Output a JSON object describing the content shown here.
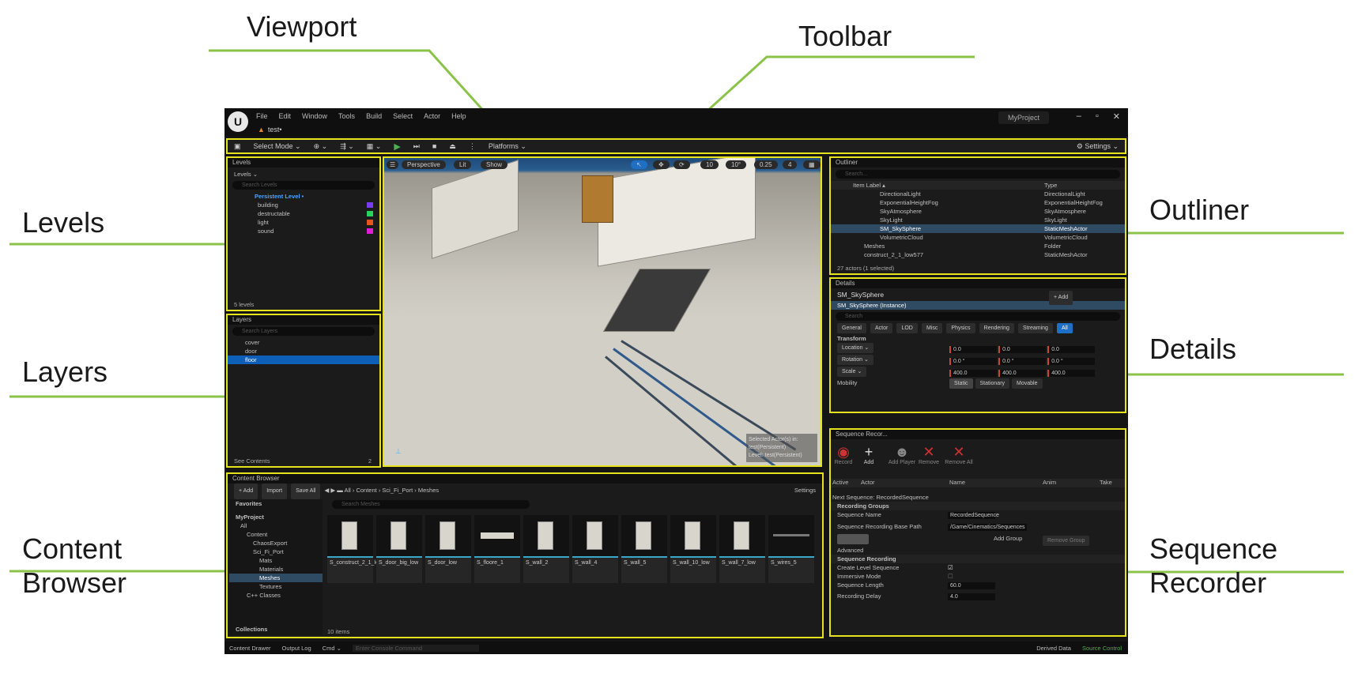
{
  "callouts": {
    "viewport": "Viewport",
    "toolbar": "Toolbar",
    "levels": "Levels",
    "layers": "Layers",
    "outliner": "Outliner",
    "details": "Details",
    "content_browser_1": "Content",
    "content_browser_2": "Browser",
    "sequence_recorder_1": "Sequence",
    "sequence_recorder_2": "Recorder"
  },
  "menubar": {
    "logo": "U",
    "items": [
      "File",
      "Edit",
      "Window",
      "Tools",
      "Build",
      "Select",
      "Actor",
      "Help"
    ],
    "tab": "test•",
    "project": "MyProject"
  },
  "toolbar": {
    "save": "💾",
    "select_mode": "Select Mode ⌄",
    "platforms": "Platforms ⌄",
    "settings": "⚙ Settings ⌄"
  },
  "levels": {
    "tab": "Levels",
    "dropdown": "Levels ⌄",
    "search": "Search Levels",
    "rows": [
      "Persistent Level •",
      "building",
      "destructable",
      "light",
      "sound"
    ],
    "colors": [
      "#b0b0b0",
      "#7a3cf0",
      "#29d35f",
      "#e6551e",
      "#e01ed8"
    ],
    "footer": "5 levels"
  },
  "layers": {
    "tab": "Layers",
    "search": "Search Layers",
    "rows": [
      "cover",
      "door",
      "floor"
    ],
    "footer": "See Contents",
    "count": "2"
  },
  "viewport": {
    "perspective": "Perspective",
    "lit": "Lit",
    "show": "Show",
    "grid": "10",
    "angle": "10°",
    "scale": "0.25",
    "cams": "4",
    "info_1": "Selected Actor(s) in:",
    "info_2": "test(Persistent)",
    "info_3": "Level: test(Persistent)"
  },
  "outliner": {
    "tab": "Outliner",
    "search": "Search...",
    "col_label": "Item Label ▴",
    "col_type": "Type",
    "rows": [
      [
        "DirectionalLight",
        "DirectionalLight"
      ],
      [
        "ExponentialHeightFog",
        "ExponentialHeightFog"
      ],
      [
        "SkyAtmosphere",
        "SkyAtmosphere"
      ],
      [
        "SkyLight",
        "SkyLight"
      ],
      [
        "SM_SkySphere",
        "StaticMeshActor"
      ],
      [
        "VolumetricCloud",
        "VolumetricCloud"
      ],
      [
        "Meshes",
        "Folder"
      ],
      [
        "construct_2_1_low577",
        "StaticMeshActor"
      ]
    ],
    "footer": "27 actors (1 selected)"
  },
  "details": {
    "tab": "Details",
    "name": "SM_SkySphere",
    "add": "+ Add",
    "instance": "SM_SkySphere (Instance)",
    "search": "Search",
    "filters": [
      "General",
      "Actor",
      "LOD",
      "Misc",
      "Physics",
      "Rendering",
      "Streaming",
      "All"
    ],
    "section": "Transform",
    "location": "Location ⌄",
    "rotation": "Rotation ⌄",
    "scale": "Scale ⌄",
    "loc": [
      "0.0",
      "0.0",
      "0.0"
    ],
    "rot": [
      "0.0 °",
      "0.0 °",
      "0.0 °"
    ],
    "scl": [
      "400.0",
      "400.0",
      "400.0"
    ],
    "mobility": "Mobility",
    "mob_opts": [
      "Static",
      "Stationary",
      "Movable"
    ]
  },
  "sequence": {
    "tab": "Sequence Recor...",
    "buttons": [
      "Record",
      "Add",
      "Add Player",
      "Remove",
      "Remove All"
    ],
    "cols": [
      "Active",
      "Actor",
      "Name",
      "Anim",
      "Take"
    ],
    "next": "Next Sequence: RecordedSequence",
    "groups": "Recording Groups",
    "seq_name_label": "Sequence Name",
    "seq_name": "RecordedSequence",
    "base_path_label": "Sequence Recording Base Path",
    "base_path": "/Game/Cinematics/Sequences",
    "add_group": "Add Group",
    "remove_group": "Remove Group",
    "advanced": "Advanced",
    "recording": "Sequence Recording",
    "create_level": "Create Level Sequence",
    "immersive": "Immersive Mode",
    "length_label": "Sequence Length",
    "length": "60.0",
    "delay_label": "Recording Delay",
    "delay": "4.0"
  },
  "content": {
    "tab": "Content Browser",
    "add": "+ Add",
    "import": "Import",
    "save_all": "Save All",
    "crumbs": [
      "All",
      "Content",
      "Sci_Fi_Port",
      "Meshes"
    ],
    "settings": "Settings",
    "favorites": "Favorites",
    "project": "MyProject",
    "tree": [
      "All",
      "Content",
      "ChaosExport",
      "Sci_Fi_Port",
      "Mats",
      "Materials",
      "Meshes",
      "Textures",
      "C++ Classes"
    ],
    "search": "Search Meshes",
    "assets": [
      "S_construct_2_1_low",
      "S_door_big_low",
      "S_door_low",
      "S_floore_1",
      "S_wall_2",
      "S_wall_4",
      "S_wall_5",
      "S_wall_10_low",
      "S_wall_7_low",
      "S_wires_5"
    ],
    "collections": "Collections",
    "count": "10 items"
  },
  "statusbar": {
    "drawer": "Content Drawer",
    "output": "Output Log",
    "cmd": "Cmd ⌄",
    "cmd_placeholder": "Enter Console Command",
    "derived": "Derived Data",
    "source": "Source Control"
  }
}
